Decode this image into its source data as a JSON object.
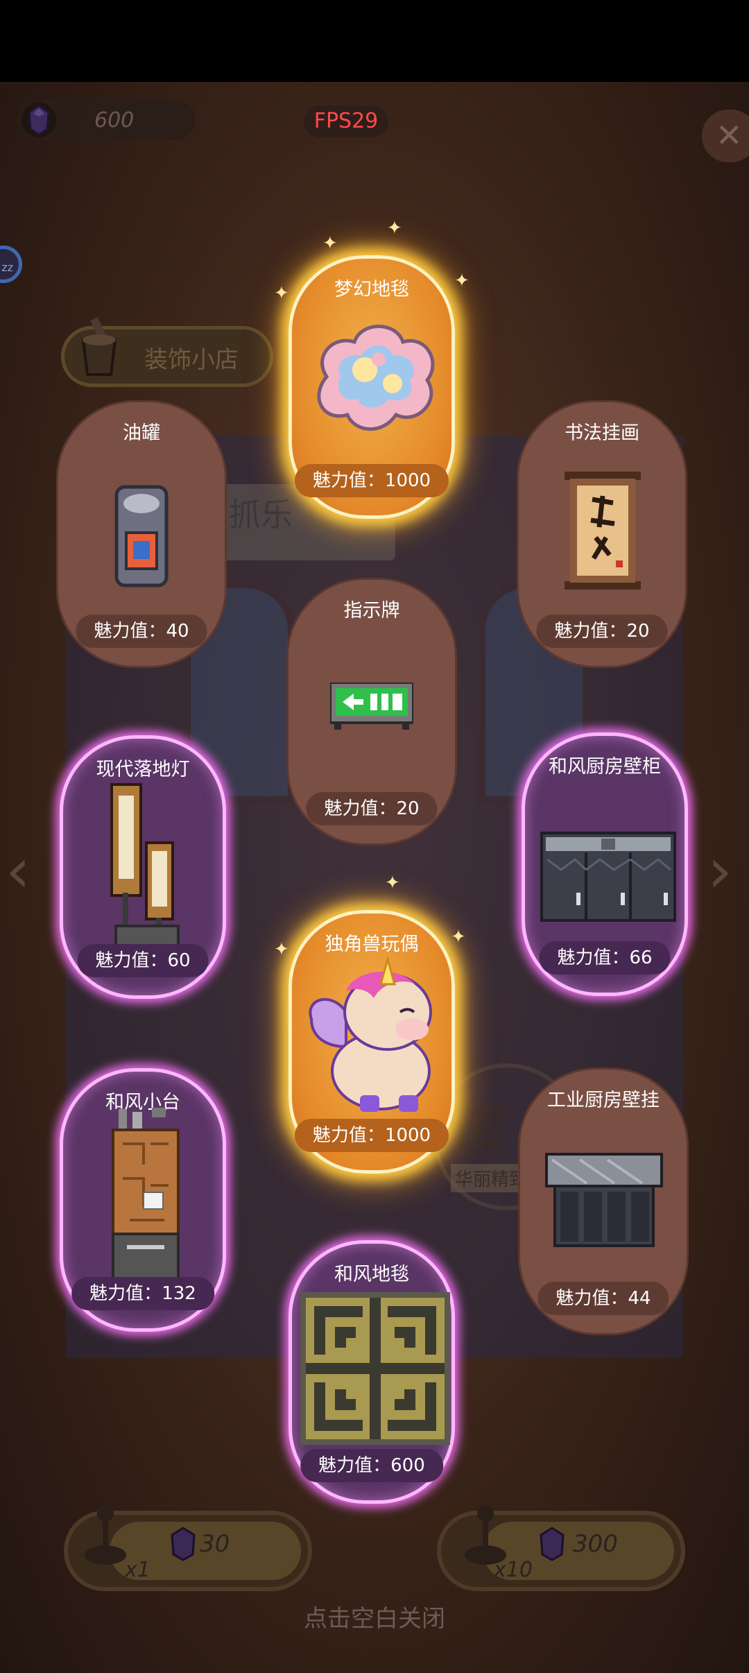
{
  "top_bar": {
    "gem_count": "600",
    "fps": "FPS29",
    "close_glyph": "✕",
    "zz_badge": "zz"
  },
  "shop": {
    "label": "装饰小店"
  },
  "background": {
    "banner_text": "抓乐",
    "seal_big": "璨",
    "seal_small": "华丽精致"
  },
  "cards": [
    {
      "name": "梦幻地毯",
      "value_label": "魅力值：1000",
      "rarity": "gold",
      "icon": "dream-rug-icon"
    },
    {
      "name": "油罐",
      "value_label": "魅力值：40",
      "rarity": "common",
      "icon": "oil-can-icon"
    },
    {
      "name": "书法挂画",
      "value_label": "魅力值：20",
      "rarity": "common",
      "icon": "calligraphy-scroll-icon"
    },
    {
      "name": "指示牌",
      "value_label": "魅力值：20",
      "rarity": "common",
      "icon": "exit-sign-icon"
    },
    {
      "name": "现代落地灯",
      "value_label": "魅力值：60",
      "rarity": "purple",
      "icon": "floor-lamp-icon"
    },
    {
      "name": "和风厨房壁柜",
      "value_label": "魅力值：66",
      "rarity": "purple",
      "icon": "kitchen-wall-cabinet-icon"
    },
    {
      "name": "独角兽玩偶",
      "value_label": "魅力值：1000",
      "rarity": "gold",
      "icon": "unicorn-plush-icon"
    },
    {
      "name": "和风小台",
      "value_label": "魅力值：132",
      "rarity": "purple",
      "icon": "japanese-counter-icon"
    },
    {
      "name": "工业厨房壁挂",
      "value_label": "魅力值：44",
      "rarity": "common",
      "icon": "industrial-wall-unit-icon"
    },
    {
      "name": "和风地毯",
      "value_label": "魅力值：600",
      "rarity": "purple",
      "icon": "japanese-rug-icon"
    }
  ],
  "gacha": [
    {
      "multiplier": "x1",
      "price": "30"
    },
    {
      "multiplier": "x10",
      "price": "300"
    }
  ],
  "hint": "点击空白关闭",
  "colors": {
    "gold_card": "#e4892a",
    "purple_card": "#5a3566",
    "brown_card": "#7a4f44",
    "fps_text": "#ff4a4a"
  }
}
